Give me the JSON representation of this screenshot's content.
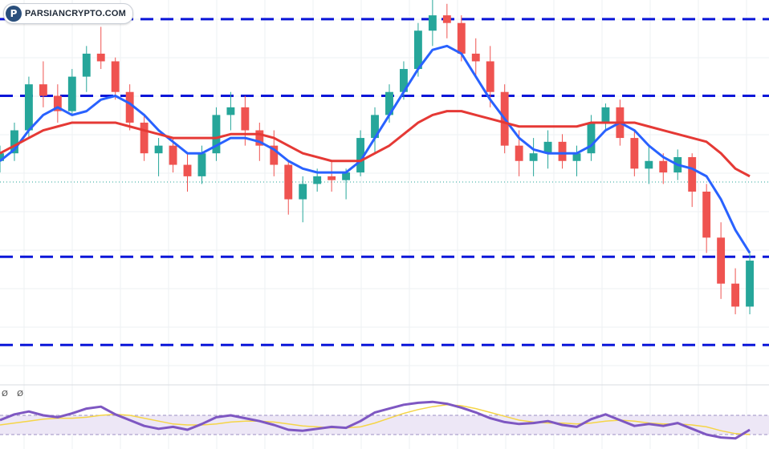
{
  "brand": {
    "text": "PARSIANCRYPTO.COM",
    "icon": "coin-logo-icon",
    "initial": "P"
  },
  "oscillator": {
    "labels": [
      "Ø",
      "Ø"
    ]
  },
  "colors": {
    "candle_up": "#26a69a",
    "candle_down": "#ef5350",
    "ma_fast": "#2962ff",
    "ma_slow": "#e53935",
    "levels": "#0a16d8",
    "osc_line": "#7e57c2",
    "osc_signal": "#f5d547",
    "osc_band": "#ede7f6"
  },
  "chart_data": [
    {
      "type": "candlestick",
      "title": "",
      "xlabel": "",
      "ylabel": "",
      "x_range": [
        0,
        160
      ],
      "ylim": [
        0,
        100
      ],
      "grid": true,
      "candles": [
        [
          0,
          58,
          62,
          55,
          60
        ],
        [
          3,
          60,
          68,
          58,
          66
        ],
        [
          6,
          66,
          80,
          64,
          78
        ],
        [
          9,
          78,
          84,
          72,
          75
        ],
        [
          12,
          75,
          78,
          68,
          71
        ],
        [
          15,
          71,
          82,
          70,
          80
        ],
        [
          18,
          80,
          88,
          76,
          86
        ],
        [
          21,
          86,
          93,
          82,
          84
        ],
        [
          24,
          84,
          85,
          74,
          76
        ],
        [
          27,
          76,
          78,
          66,
          68
        ],
        [
          30,
          68,
          70,
          58,
          60
        ],
        [
          33,
          60,
          64,
          54,
          62
        ],
        [
          36,
          62,
          64,
          55,
          57
        ],
        [
          39,
          57,
          60,
          50,
          54
        ],
        [
          42,
          54,
          62,
          52,
          60
        ],
        [
          45,
          60,
          72,
          58,
          70
        ],
        [
          48,
          70,
          76,
          66,
          72
        ],
        [
          51,
          72,
          75,
          62,
          66
        ],
        [
          54,
          66,
          68,
          58,
          62
        ],
        [
          57,
          62,
          66,
          54,
          57
        ],
        [
          60,
          57,
          58,
          44,
          48
        ],
        [
          63,
          48,
          54,
          42,
          52
        ],
        [
          66,
          52,
          56,
          50,
          54
        ],
        [
          69,
          54,
          58,
          50,
          53
        ],
        [
          72,
          53,
          56,
          48,
          55
        ],
        [
          75,
          55,
          66,
          54,
          64
        ],
        [
          78,
          64,
          72,
          60,
          70
        ],
        [
          81,
          70,
          78,
          68,
          76
        ],
        [
          84,
          76,
          84,
          74,
          82
        ],
        [
          87,
          82,
          94,
          80,
          92
        ],
        [
          90,
          92,
          100,
          88,
          96
        ],
        [
          93,
          96,
          99,
          90,
          94
        ],
        [
          96,
          94,
          96,
          84,
          86
        ],
        [
          99,
          86,
          90,
          80,
          84
        ],
        [
          102,
          84,
          88,
          72,
          76
        ],
        [
          105,
          76,
          78,
          60,
          62
        ],
        [
          108,
          62,
          66,
          54,
          58
        ],
        [
          111,
          58,
          64,
          54,
          60
        ],
        [
          114,
          60,
          66,
          56,
          63
        ],
        [
          117,
          63,
          65,
          56,
          58
        ],
        [
          120,
          58,
          62,
          54,
          60
        ],
        [
          123,
          60,
          70,
          58,
          68
        ],
        [
          126,
          68,
          73,
          66,
          72
        ],
        [
          129,
          72,
          74,
          62,
          64
        ],
        [
          132,
          64,
          66,
          54,
          56
        ],
        [
          135,
          56,
          62,
          52,
          58
        ],
        [
          138,
          58,
          60,
          52,
          55
        ],
        [
          141,
          55,
          61,
          53,
          59
        ],
        [
          144,
          59,
          60,
          46,
          50
        ],
        [
          147,
          50,
          52,
          34,
          38
        ],
        [
          150,
          38,
          42,
          22,
          26
        ],
        [
          153,
          26,
          30,
          18,
          20
        ],
        [
          156,
          20,
          34,
          18,
          32
        ]
      ],
      "series": [
        {
          "values": [
            58,
            61,
            66,
            70,
            72,
            70,
            71,
            74,
            75,
            73,
            70,
            66,
            63,
            60,
            60,
            62,
            64,
            64,
            63,
            61,
            58,
            56,
            55,
            55,
            55,
            58,
            64,
            70,
            76,
            82,
            87,
            88,
            86,
            80,
            74,
            69,
            64,
            61,
            60,
            60,
            60,
            62,
            66,
            68,
            66,
            62,
            59,
            57,
            56,
            54,
            48,
            40,
            34
          ]
        },
        {
          "values": [
            60,
            62,
            64,
            66,
            67,
            68,
            68,
            68,
            68,
            67,
            66,
            65,
            64,
            64,
            64,
            64,
            65,
            65,
            65,
            64,
            62,
            60,
            59,
            58,
            58,
            58,
            60,
            62,
            65,
            68,
            70,
            71,
            71,
            70,
            69,
            68,
            67,
            67,
            67,
            67,
            67,
            68,
            68,
            68,
            68,
            67,
            66,
            65,
            64,
            63,
            60,
            56,
            54
          ]
        }
      ],
      "levels": [
        95,
        75,
        33,
        10
      ]
    },
    {
      "type": "line",
      "title": "",
      "xlabel": "",
      "ylabel": "",
      "ylim": [
        0,
        100
      ],
      "bands": [
        30,
        70
      ],
      "series": [
        {
          "values": [
            60,
            72,
            78,
            70,
            66,
            74,
            84,
            88,
            72,
            60,
            48,
            42,
            46,
            40,
            52,
            66,
            70,
            64,
            58,
            50,
            40,
            38,
            42,
            46,
            44,
            58,
            76,
            84,
            92,
            96,
            98,
            94,
            86,
            76,
            64,
            56,
            52,
            54,
            58,
            50,
            46,
            62,
            72,
            60,
            48,
            52,
            48,
            54,
            42,
            30,
            24,
            22,
            40
          ]
        },
        {
          "values": [
            50,
            54,
            58,
            62,
            64,
            64,
            66,
            70,
            72,
            70,
            64,
            58,
            52,
            50,
            50,
            52,
            56,
            58,
            58,
            56,
            52,
            48,
            46,
            44,
            44,
            46,
            54,
            64,
            74,
            82,
            88,
            92,
            90,
            84,
            76,
            68,
            60,
            56,
            54,
            54,
            52,
            54,
            58,
            60,
            58,
            54,
            52,
            52,
            50,
            46,
            38,
            32,
            30
          ]
        }
      ]
    }
  ]
}
